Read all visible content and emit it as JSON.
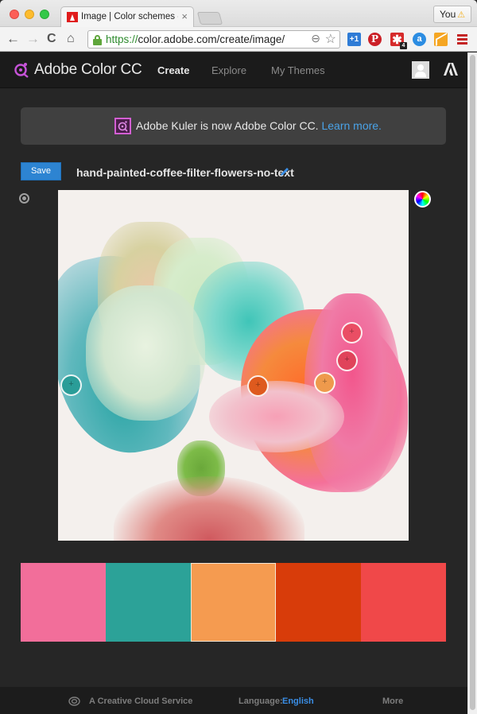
{
  "browser": {
    "tab_title": "Image | Color schemes - Adobe Color CC",
    "tab_close": "×",
    "profile_label": "You",
    "profile_warning": "⚠",
    "url_scheme": "https://",
    "url_rest": "color.adobe.com/create/image/",
    "nav_back": "←",
    "nav_forward": "→",
    "nav_reload": "C",
    "nav_home": "⌂",
    "zoom_glyph": "⊖",
    "star_glyph": "☆",
    "extensions": [
      {
        "name": "google-plus-one",
        "label": "+1"
      },
      {
        "name": "pinterest",
        "label": "P"
      },
      {
        "name": "asterisk",
        "label": "✱",
        "badge": "4"
      },
      {
        "name": "amazon-assistant",
        "label": "a"
      },
      {
        "name": "analytics",
        "label": ""
      }
    ]
  },
  "app": {
    "title": "Adobe Color CC",
    "nav": [
      {
        "label": "Create",
        "active": true
      },
      {
        "label": "Explore",
        "active": false
      },
      {
        "label": "My Themes",
        "active": false
      }
    ]
  },
  "banner": {
    "text": "Adobe Kuler is now Adobe Color CC. ",
    "link": "Learn more."
  },
  "theme": {
    "save_label": "Save",
    "name": "hand-painted-coffee-filter-flowers-no-text"
  },
  "pickers": [
    {
      "color": "#2a9d98",
      "label": "teal picker"
    },
    {
      "color": "#de5a1e",
      "label": "orange-red picker"
    },
    {
      "color": "#ee9a4c",
      "label": "orange picker",
      "selected": true
    },
    {
      "color": "#ea4e64",
      "label": "pink picker"
    },
    {
      "color": "#e0435a",
      "label": "red picker"
    }
  ],
  "swatches": [
    {
      "color": "#f26e9a"
    },
    {
      "color": "#2ca298"
    },
    {
      "color": "#f59b50",
      "selected": true
    },
    {
      "color": "#d83c0a"
    },
    {
      "color": "#f04849"
    }
  ],
  "footer": {
    "service": "A Creative Cloud Service",
    "language_label": "Language:",
    "language": "English",
    "more": "More"
  }
}
